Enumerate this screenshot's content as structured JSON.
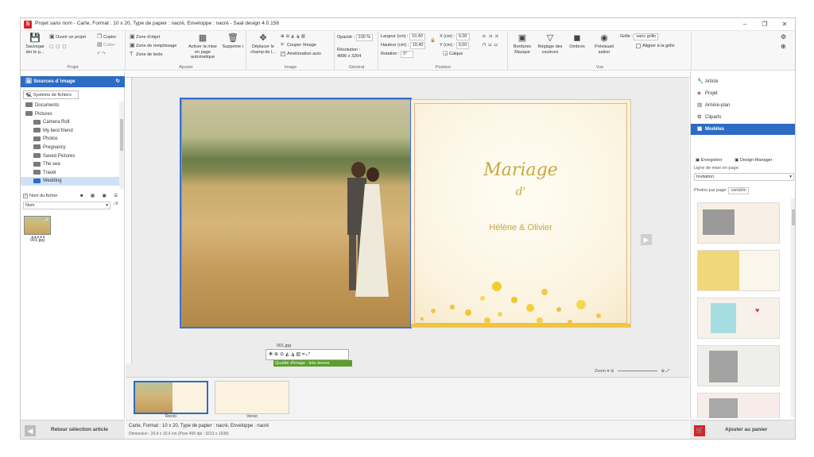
{
  "window": {
    "title": "Projet sans nom - Carte, Format : 10 x 20, Type de papier : nacré, Enveloppe : nacré - Saal design 4.0.156",
    "app_icon_letter": "S"
  },
  "ribbon": {
    "projet": {
      "label": "Projet",
      "save": "Sauvegar der le p...",
      "open": "Ouvrir un projet",
      "copy": "Copier",
      "paste": "Coller"
    },
    "ajouter": {
      "label": "Ajouter",
      "zone_objet": "Zone d'objet",
      "zone_remplissage": "Zone de remplissage",
      "zone_texte": "Zone de texte",
      "activer": "Activer la mise en page automatique",
      "supprimer": "Supprime r"
    },
    "image": {
      "label": "Image",
      "deplacer": "Déplacer le champ de l...",
      "couper": "Couper l'image",
      "amelioration": "Amélioration auto"
    },
    "general": {
      "label": "Général",
      "opacite_label": "Opacité :",
      "opacite_value": "100 %",
      "resolution_label": "Résolution :",
      "resolution_value": "4896 x 3264"
    },
    "position": {
      "label": "Position",
      "largeur_label": "Largeur (cm) :",
      "largeur_value": "10,40",
      "hauteur_label": "Hauteur (cm) :",
      "hauteur_value": "10,40",
      "rotation_label": "Rotation :",
      "rotation_value": "0°",
      "x_label": "X (cm) :",
      "x_value": "0,00",
      "y_label": "Y (cm) :",
      "y_value": "0,00",
      "calque": "Calque"
    },
    "vue": {
      "label": "Vue",
      "bordures": "Bordures Masque",
      "reglage": "Réglage des couleurs",
      "ombres": "Ombres",
      "previsualisation": "Prévisuali sation",
      "grille_label": "Grille :",
      "grille_value": "sans grille",
      "aligner": "Aligner à la grille"
    }
  },
  "left_panel": {
    "header": "Sources d´image",
    "tab": "Système de fichiers",
    "tree": [
      {
        "label": "Documents",
        "indent": 1
      },
      {
        "label": "Pictures",
        "indent": 1
      },
      {
        "label": "Camera Roll",
        "indent": 2
      },
      {
        "label": "My best friend",
        "indent": 2
      },
      {
        "label": "Photos",
        "indent": 2
      },
      {
        "label": "Pregnancy",
        "indent": 2
      },
      {
        "label": "Saved Pictures",
        "indent": 2
      },
      {
        "label": "The sea",
        "indent": 2
      },
      {
        "label": "Travel",
        "indent": 2
      },
      {
        "label": "Wedding",
        "indent": 2,
        "selected": true
      }
    ],
    "show_filename": "Nom du fichier",
    "sort_label": "Nom",
    "thumb_label": "001.jpg",
    "back_button": "Retour sélection article"
  },
  "canvas": {
    "title_line1": "Mariage",
    "title_line2": "d'",
    "names": "Hélène & Olivier",
    "photo_name": "001.jpg",
    "quality": "Qualité d'image : très bonne",
    "zoom_label": "Zoom",
    "pages": [
      {
        "label": "Recto",
        "active": true
      },
      {
        "label": "Verso",
        "active": false
      }
    ]
  },
  "status": {
    "line1": "Carte, Format : 10 x 20, Type de papier : nacré, Enveloppe : nacré",
    "line2": "Dimension : 20,4 x 10,4 cm (Pixel 400 dpi : 3213 x 1638)"
  },
  "right_panel": {
    "items": [
      {
        "label": "Article",
        "icon": "wrench-icon"
      },
      {
        "label": "Projet",
        "icon": "cube-icon"
      },
      {
        "label": "Arrière-plan",
        "icon": "image-icon"
      },
      {
        "label": "Cliparts",
        "icon": "clipart-icon"
      },
      {
        "label": "Modèles",
        "icon": "grid-icon",
        "active": true
      }
    ],
    "enregistrer": "Enregistrer",
    "design_manager": "Design-Manager",
    "layout_label": "Ligne de mise en page:",
    "layout_value": "Invitation",
    "photos_label": "Photos par page:",
    "photos_value": "variable",
    "cart_button": "Ajouter au panier"
  },
  "colors": {
    "accent": "#2d6bc4",
    "brand": "#d8232a",
    "quality_ok": "#5a9e2b",
    "title_gold": "#c9a840"
  }
}
